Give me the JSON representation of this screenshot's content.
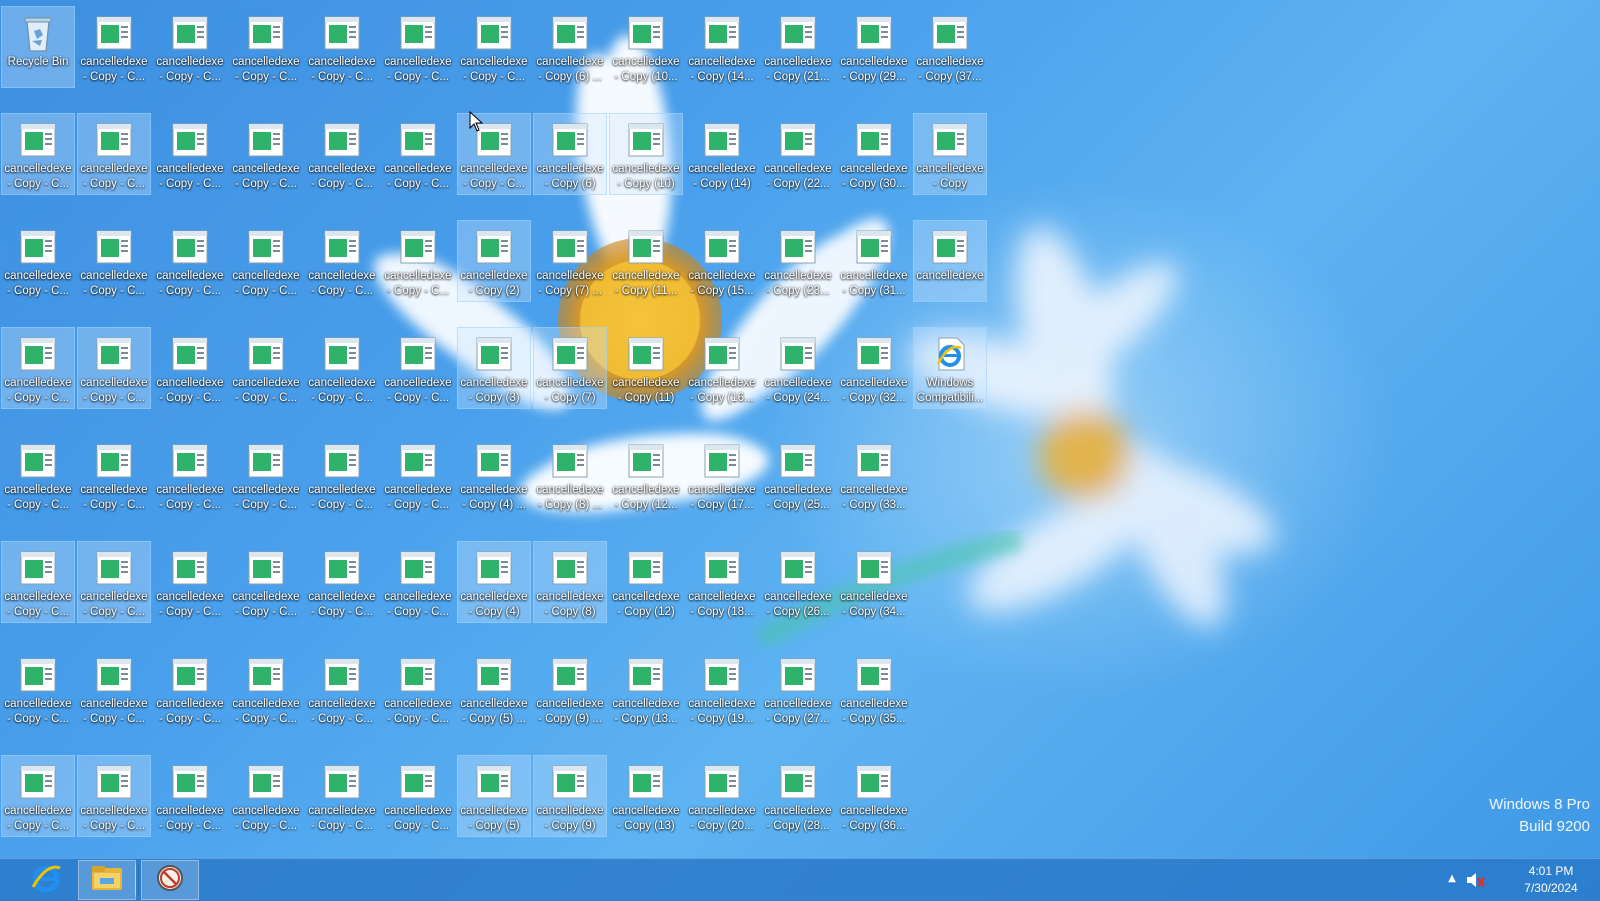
{
  "desktop": {
    "recycle_bin_label": "Recycle Bin",
    "rows": [
      [
        "Recycle Bin",
        "cancelledexe\n- Copy - C...",
        "cancelledexe\n- Copy - C...",
        "cancelledexe\n- Copy - C...",
        "cancelledexe\n- Copy - C...",
        "cancelledexe\n- Copy - C...",
        "cancelledexe\n- Copy - C...",
        "cancelledexe\n- Copy (6) ...",
        "cancelledexe\n- Copy (10...",
        "cancelledexe\n- Copy (14...",
        "cancelledexe\n- Copy (21...",
        "cancelledexe\n- Copy (29...",
        "cancelledexe\n- Copy (37..."
      ],
      [
        "cancelledexe\n- Copy - C...",
        "cancelledexe\n- Copy - C...",
        "cancelledexe\n- Copy - C...",
        "cancelledexe\n- Copy - C...",
        "cancelledexe\n- Copy - C...",
        "cancelledexe\n- Copy - C...",
        "cancelledexe\n- Copy - C...",
        "cancelledexe\n- Copy (6)",
        "cancelledexe\n- Copy (10)",
        "cancelledexe\n- Copy (14)",
        "cancelledexe\n- Copy (22...",
        "cancelledexe\n- Copy (30...",
        "cancelledexe\n- Copy"
      ],
      [
        "cancelledexe\n- Copy - C...",
        "cancelledexe\n- Copy - C...",
        "cancelledexe\n- Copy - C...",
        "cancelledexe\n- Copy - C...",
        "cancelledexe\n- Copy - C...",
        "cancelledexe\n- Copy - C...",
        "cancelledexe\n- Copy (2)",
        "cancelledexe\n- Copy (7) ...",
        "cancelledexe\n- Copy (11...",
        "cancelledexe\n- Copy (15...",
        "cancelledexe\n- Copy (23...",
        "cancelledexe\n- Copy (31...",
        "cancelledexe"
      ],
      [
        "cancelledexe\n- Copy - C...",
        "cancelledexe\n- Copy - C...",
        "cancelledexe\n- Copy - C...",
        "cancelledexe\n- Copy - C...",
        "cancelledexe\n- Copy - C...",
        "cancelledexe\n- Copy - C...",
        "cancelledexe\n- Copy (3)",
        "cancelledexe\n- Copy (7)",
        "cancelledexe\n- Copy (11)",
        "cancelledexe\n- Copy (16...",
        "cancelledexe\n- Copy (24...",
        "cancelledexe\n- Copy (32...",
        "Windows\nCompatibili..."
      ],
      [
        "cancelledexe\n- Copy - C...",
        "cancelledexe\n- Copy - C...",
        "cancelledexe\n- Copy - C...",
        "cancelledexe\n- Copy - C...",
        "cancelledexe\n- Copy - C...",
        "cancelledexe\n- Copy - C...",
        "cancelledexe\n- Copy (4) ...",
        "cancelledexe\n- Copy (8) ...",
        "cancelledexe\n- Copy (12...",
        "cancelledexe\n- Copy (17...",
        "cancelledexe\n- Copy (25...",
        "cancelledexe\n- Copy (33..."
      ],
      [
        "cancelledexe\n- Copy - C...",
        "cancelledexe\n- Copy - C...",
        "cancelledexe\n- Copy - C...",
        "cancelledexe\n- Copy - C...",
        "cancelledexe\n- Copy - C...",
        "cancelledexe\n- Copy - C...",
        "cancelledexe\n- Copy (4)",
        "cancelledexe\n- Copy (8)",
        "cancelledexe\n- Copy (12)",
        "cancelledexe\n- Copy (18...",
        "cancelledexe\n- Copy (26...",
        "cancelledexe\n- Copy (34..."
      ],
      [
        "cancelledexe\n- Copy - C...",
        "cancelledexe\n- Copy - C...",
        "cancelledexe\n- Copy - C...",
        "cancelledexe\n- Copy - C...",
        "cancelledexe\n- Copy - C...",
        "cancelledexe\n- Copy - C...",
        "cancelledexe\n- Copy (5) ...",
        "cancelledexe\n- Copy (9) ...",
        "cancelledexe\n- Copy (13...",
        "cancelledexe\n- Copy (19...",
        "cancelledexe\n- Copy (27...",
        "cancelledexe\n- Copy (35..."
      ],
      [
        "cancelledexe\n- Copy - C...",
        "cancelledexe\n- Copy - C...",
        "cancelledexe\n- Copy - C...",
        "cancelledexe\n- Copy - C...",
        "cancelledexe\n- Copy - C...",
        "cancelledexe\n- Copy - C...",
        "cancelledexe\n- Copy (5)",
        "cancelledexe\n- Copy (9)",
        "cancelledexe\n- Copy (13)",
        "cancelledexe\n- Copy (20...",
        "cancelledexe\n- Copy (28...",
        "cancelledexe\n- Copy (36..."
      ]
    ],
    "selected": [
      [
        0,
        0
      ],
      [
        1,
        0
      ],
      [
        1,
        1
      ],
      [
        1,
        6
      ],
      [
        1,
        7
      ],
      [
        1,
        8
      ],
      [
        1,
        12
      ],
      [
        2,
        6
      ],
      [
        2,
        12
      ],
      [
        3,
        0
      ],
      [
        3,
        1
      ],
      [
        3,
        6
      ],
      [
        3,
        7
      ],
      [
        3,
        12
      ],
      [
        5,
        0
      ],
      [
        5,
        1
      ],
      [
        5,
        6
      ],
      [
        5,
        7
      ],
      [
        7,
        0
      ],
      [
        7,
        1
      ],
      [
        7,
        6
      ],
      [
        7,
        7
      ]
    ]
  },
  "watermark": {
    "line1": "Windows 8 Pro",
    "line2": "Build 9200"
  },
  "taskbar": {
    "pinned": [
      {
        "name": "internet-explorer-icon"
      },
      {
        "name": "file-explorer-icon"
      },
      {
        "name": "app-icon"
      }
    ]
  },
  "tray": {
    "show_hidden_glyph": "▲",
    "time": "4:01 PM",
    "date": "7/30/2024"
  },
  "colors": {
    "sky_blue": "#4aa0ec",
    "taskbar": "#2878c8",
    "selection": "#cde8ff"
  }
}
